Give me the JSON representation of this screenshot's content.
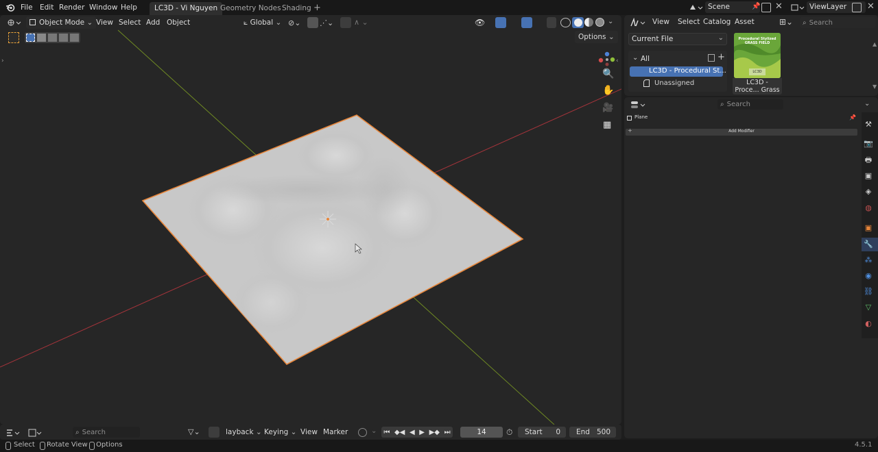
{
  "menubar": {
    "items": [
      "File",
      "Edit",
      "Render",
      "Window",
      "Help"
    ],
    "tabs": [
      "LC3D - Vi Nguyen",
      "Geometry Nodes",
      "Shading"
    ],
    "add_tab": "+",
    "scene": "Scene",
    "view_layer": "ViewLayer"
  },
  "viewport": {
    "mode": "Object Mode",
    "menus": [
      "View",
      "Select",
      "Add",
      "Object"
    ],
    "transform_orientation": "Global",
    "options": "Options"
  },
  "asset_browser": {
    "menus": [
      "View",
      "Select",
      "Catalog",
      "Asset"
    ],
    "search_placeholder": "Search",
    "library": "Current File",
    "tree_all": "All",
    "catalog_selected": "LC3D - Procedural St...",
    "catalog_unassigned": "Unassigned",
    "asset_thumb_title": "Procedural Stylized GRASS FIELD",
    "asset_thumb_sub": "LC3D",
    "asset_name_line1": "LC3D -",
    "asset_name_line2": "Proce... Grass"
  },
  "properties": {
    "search_placeholder": "Search",
    "object_name": "Plane",
    "add_modifier": "Add Modifier"
  },
  "timeline": {
    "search_placeholder": "Search",
    "menus": [
      "layback",
      "Keying",
      "View",
      "Marker"
    ],
    "current_frame": "14",
    "start_label": "Start",
    "start_value": "0",
    "end_label": "End",
    "end_value": "500"
  },
  "statusbar": {
    "select": "Select",
    "rotate": "Rotate View",
    "options": "Options",
    "version": "4.5.1"
  },
  "colors": {
    "accent": "#4772b3",
    "x_axis": "#b0353e",
    "y_axis": "#7a9b22",
    "selection_outline": "#e8863a",
    "plane": "#c9c9c9"
  }
}
